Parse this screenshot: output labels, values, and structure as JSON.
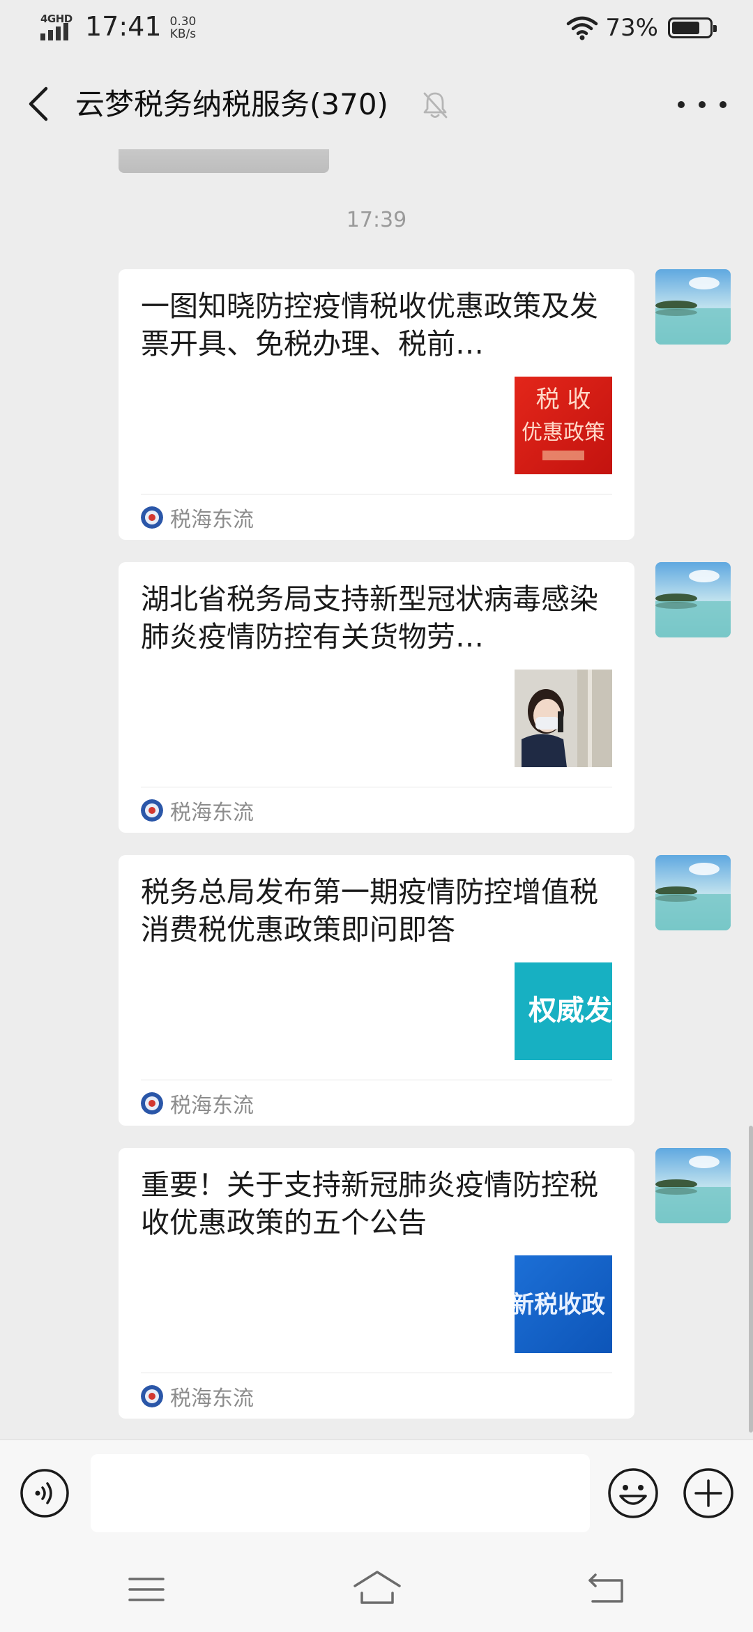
{
  "status_bar": {
    "network": "4GHD",
    "time": "17:41",
    "speed_value": "0.30",
    "speed_unit": "KB/s",
    "battery_percent": "73%"
  },
  "header": {
    "title": "云梦税务纳税服务(370)"
  },
  "chat": {
    "timestamp": "17:39",
    "messages": [
      {
        "title": "一图知晓防控疫情税收优惠政策及发票开具、免税办理、税前…",
        "thumb_text": "税 收 优惠政策",
        "source": "税海东流"
      },
      {
        "title": "湖北省税务局支持新型冠状病毒感染肺炎疫情防控有关货物劳…",
        "thumb_text": "",
        "source": "税海东流"
      },
      {
        "title": "税务总局发布第一期疫情防控增值税消费税优惠政策即问即答",
        "thumb_text": "权威发",
        "source": "税海东流"
      },
      {
        "title": "重要！关于支持新冠肺炎疫情防控税收优惠政策的五个公告",
        "thumb_text": "新税收政策",
        "source": "税海东流"
      }
    ]
  },
  "input": {
    "placeholder": ""
  },
  "icons": {
    "back": "back-arrow-icon",
    "mute": "mute-bell-icon",
    "more": "more-icon",
    "voice": "voice-icon",
    "emoji": "emoji-icon",
    "plus": "plus-icon"
  },
  "colors": {
    "background": "#ededed",
    "card": "#ffffff",
    "secondary_text": "#8c8c8c"
  }
}
